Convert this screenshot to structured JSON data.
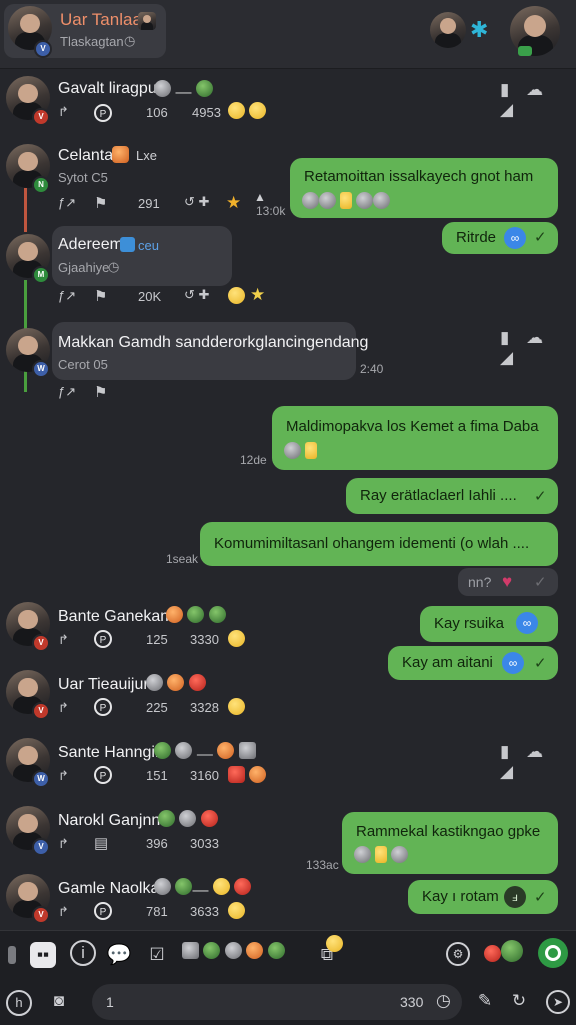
{
  "header": {
    "title": "Uar Tanlaai",
    "subtitle": "Tlaskagtan",
    "badge": "V"
  },
  "messages_in": [
    {
      "name": "Gavalt liragpui",
      "stat1": "106",
      "stat2": "4953",
      "badge": "V",
      "badge_color": "#c0392b"
    },
    {
      "name": "Celantal",
      "tag": "Lxe",
      "sub": "Sytot C5",
      "stat1": "291",
      "stat_time": "13:0k",
      "badge": "N",
      "badge_color": "#2e8b3c"
    },
    {
      "name": "Adereem",
      "tag": "ceu",
      "sub": "Gjaahiye",
      "stat1": "20K",
      "badge": "M",
      "badge_color": "#2e8b3c"
    },
    {
      "name": "Makkan Gamdh sandderorkglancingendang",
      "sub": "Cerot 05",
      "time": "2:40",
      "badge": "W",
      "badge_color": "#3d5fa8"
    },
    {
      "name": "Bante Ganekam",
      "stat1": "125",
      "stat2": "3330",
      "badge": "V",
      "badge_color": "#c0392b"
    },
    {
      "name": "Uar Tieauijun",
      "stat1": "225",
      "stat2": "3328",
      "badge": "V",
      "badge_color": "#c0392b"
    },
    {
      "name": "Sante Hanngim",
      "stat1": "151",
      "stat2": "3160",
      "badge": "W",
      "badge_color": "#3d5fa8"
    },
    {
      "name": "Narokl Ganjnn",
      "stat1": "396",
      "stat2": "3033",
      "badge": "V",
      "badge_color": "#3d5fa8"
    },
    {
      "name": "Gamle Naolka",
      "stat1": "781",
      "stat2": "3633",
      "badge": "V",
      "badge_color": "#c0392b"
    }
  ],
  "messages_out": [
    {
      "text": "Retamoittan issalkayech gnot ham"
    },
    {
      "text": "Ritrde"
    },
    {
      "text": "Maldimopakva los Kemet a fima Daba",
      "time": "12de"
    },
    {
      "text": "Ray erätlaclaerl Iahli ...."
    },
    {
      "text": "Komumimiltasanl ohangem idementi (o wlah ....",
      "time": "1seak"
    },
    {
      "text": "nn?"
    },
    {
      "text": "Kay rsuika"
    },
    {
      "text": "Kay am aitani"
    },
    {
      "text": "Rammekal kastikngao gpke",
      "time": "133ac"
    },
    {
      "text": "Kay ı rotam"
    }
  ],
  "composer": {
    "value": "1",
    "counter": "330"
  },
  "colors": {
    "background": "#25262b",
    "outgoing_bubble": "#62b455",
    "incoming_bubble": "#3a3b41",
    "accent_blue": "#3b87e8",
    "accent_green": "#2e9a44"
  }
}
